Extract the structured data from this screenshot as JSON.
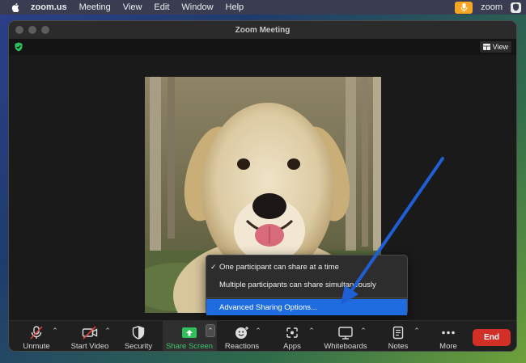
{
  "menubar": {
    "app_name": "zoom.us",
    "items": [
      "Meeting",
      "View",
      "Edit",
      "Window",
      "Help"
    ],
    "status_zoom_label": "zoom",
    "mic_color": "#f5a623"
  },
  "window": {
    "title": "Zoom Meeting",
    "view_label": "View"
  },
  "share_menu": {
    "option_one": "One participant can share at a time",
    "option_one_checked": true,
    "option_multi": "Multiple participants can share simultaneously",
    "advanced": "Advanced Sharing Options..."
  },
  "toolbar": {
    "unmute": "Unmute",
    "start_video": "Start Video",
    "security": "Security",
    "share_screen": "Share Screen",
    "reactions": "Reactions",
    "apps": "Apps",
    "whiteboards": "Whiteboards",
    "notes": "Notes",
    "more": "More",
    "end": "End"
  },
  "colors": {
    "share_green": "#3ec46d",
    "end_red": "#d22f27",
    "highlight_blue": "#1e6ce0",
    "annotation_arrow": "#1f5fd6"
  },
  "icons": {
    "apple": "apple-icon",
    "encryption": "green-shield-icon",
    "view": "grid-icon",
    "muted_mic": "mic-off-icon",
    "video_off": "video-off-icon",
    "security": "shield-icon",
    "share": "share-up-arrow-icon",
    "reactions": "emoji-plus-icon",
    "apps": "apps-icon",
    "whiteboard": "whiteboard-icon",
    "notes": "notes-icon",
    "more": "ellipsis-icon"
  }
}
